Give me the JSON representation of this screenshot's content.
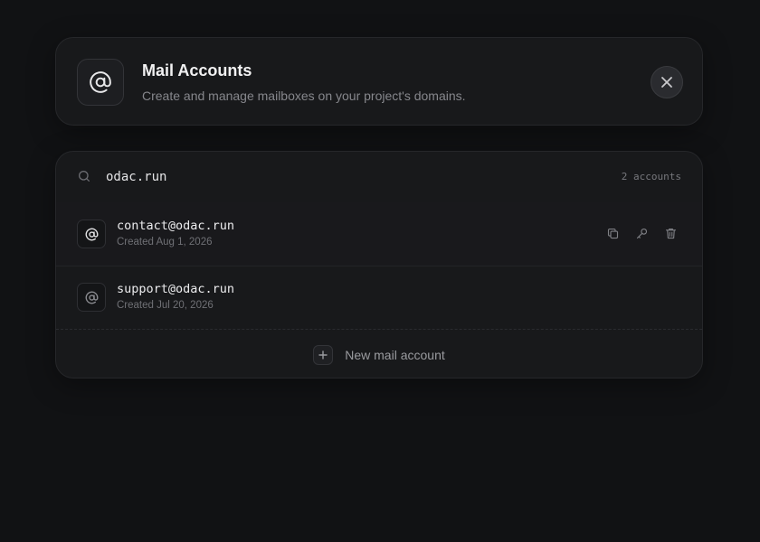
{
  "header": {
    "icon": "at-sign-icon",
    "title": "Mail Accounts",
    "subtitle": "Create and manage mailboxes on your project's domains.",
    "close_icon": "close-icon"
  },
  "search": {
    "value": "odac.run",
    "icon": "search-icon",
    "count_label": "2 accounts"
  },
  "accounts": [
    {
      "email": "contact@odac.run",
      "created": "Created Aug 1, 2026",
      "icon": "at-sign-icon",
      "actions": [
        "copy-icon",
        "key-icon",
        "trash-icon"
      ]
    },
    {
      "email": "support@odac.run",
      "created": "Created Jul 20, 2026",
      "icon": "at-sign-icon"
    }
  ],
  "new_account": {
    "label": "New mail account",
    "icon": "plus-icon"
  },
  "colors": {
    "background": "#111214",
    "card": "#18191b",
    "border": "#26272a"
  }
}
